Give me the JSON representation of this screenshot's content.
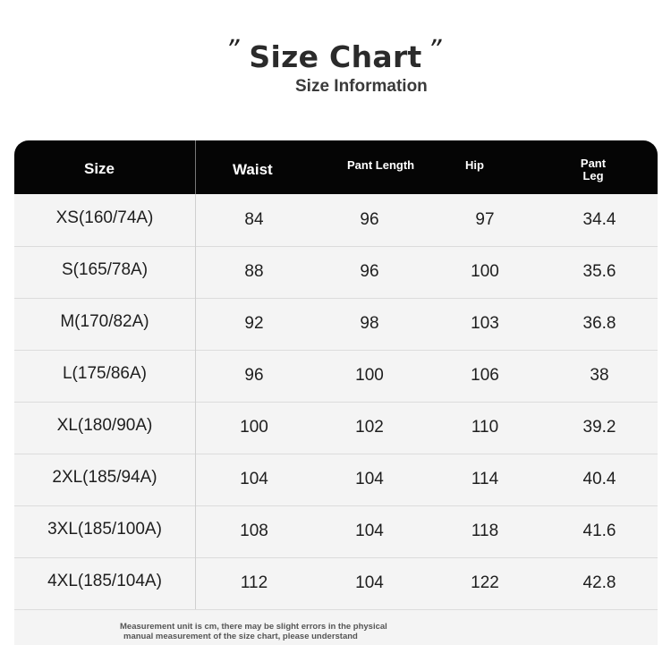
{
  "header": {
    "open_quote": "”",
    "title": "Size Chart",
    "close_quote": "”",
    "subtitle": "Size Information"
  },
  "table": {
    "columns": {
      "size": "Size",
      "waist": "Waist",
      "pant_length": "Pant Length",
      "hip": "Hip",
      "pant_leg_line1": "Pant",
      "pant_leg_line2": "Leg"
    },
    "rows": [
      {
        "size": "XS(160/74A)",
        "waist": "84",
        "pant_length": "96",
        "hip": "97",
        "pant_leg": "34.4"
      },
      {
        "size": "S(165/78A)",
        "waist": "88",
        "pant_length": "96",
        "hip": "100",
        "pant_leg": "35.6"
      },
      {
        "size": "M(170/82A)",
        "waist": "92",
        "pant_length": "98",
        "hip": "103",
        "pant_leg": "36.8"
      },
      {
        "size": "L(175/86A)",
        "waist": "96",
        "pant_length": "100",
        "hip": "106",
        "pant_leg": "38"
      },
      {
        "size": "XL(180/90A)",
        "waist": "100",
        "pant_length": "102",
        "hip": "110",
        "pant_leg": "39.2"
      },
      {
        "size": "2XL(185/94A)",
        "waist": "104",
        "pant_length": "104",
        "hip": "114",
        "pant_leg": "40.4"
      },
      {
        "size": "3XL(185/100A)",
        "waist": "108",
        "pant_length": "104",
        "hip": "118",
        "pant_leg": "41.6"
      },
      {
        "size": "4XL(185/104A)",
        "waist": "112",
        "pant_length": "104",
        "hip": "122",
        "pant_leg": "42.8"
      }
    ]
  },
  "footnote": {
    "line1": "Measurement unit is cm, there may be slight errors in the physical",
    "line2": "manual measurement of the size chart, please understand"
  },
  "colors": {
    "header_bg": "#050505",
    "table_bg": "#f4f4f4",
    "text": "#1e1e1e"
  }
}
